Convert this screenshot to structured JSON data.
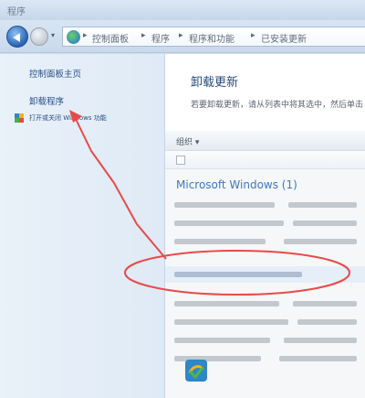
{
  "window": {
    "title": "程序"
  },
  "navigation": {
    "back_icon": "back-arrow-icon",
    "forward_icon": "forward-arrow-icon",
    "dropdown_glyph": "▾",
    "separator": "▸",
    "breadcrumbs": [
      "控制面板",
      "程序",
      "程序和功能",
      "已安装更新"
    ]
  },
  "left_pane": {
    "tasks": [
      {
        "label": "控制面板主页"
      },
      {
        "label": "卸载程序"
      },
      {
        "label": "打开或关闭 Windows 功能"
      }
    ]
  },
  "main": {
    "title": "卸载更新",
    "description": "若要卸载更新，请从列表中将其选中，然后单击",
    "toolbar": {
      "organize_label": "组织 ▾"
    },
    "group_header": "Microsoft Windows (1)"
  },
  "annotation": {
    "color": "#e84a4a"
  },
  "colors": {
    "link": "#274f85",
    "group": "#3e78c4",
    "accent": "#e84a4a"
  }
}
